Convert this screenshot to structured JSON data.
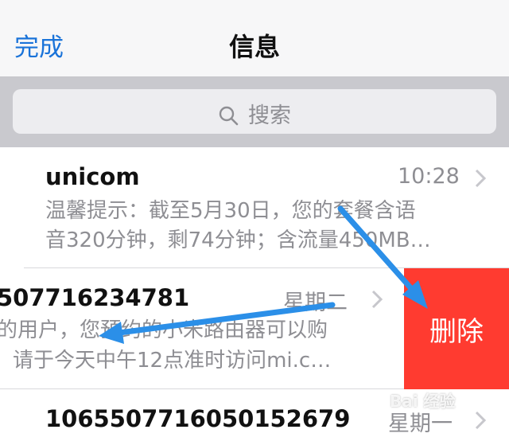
{
  "navbar": {
    "done_label": "完成",
    "title": "信息"
  },
  "search": {
    "placeholder": "搜索"
  },
  "messages": [
    {
      "sender": "unicom",
      "time": "10:28",
      "preview_line1": "温馨提示：截至5月30日，您的套餐含语",
      "preview_line2": "音320分钟，剩74分钟；含流量450MB…"
    },
    {
      "sender": "507716234781",
      "time": "星期二",
      "preview_line1": "的用户，您预约的小米路由器可以购",
      "preview_line2": "请于今天中午12点准时访问mi.c…"
    },
    {
      "sender": "1065507716050152679",
      "time": "星期一"
    }
  ],
  "swipe_action": {
    "delete_label": "删除",
    "color": "#ff3b30"
  },
  "annotation": {
    "arrow_color": "#2b8fe8"
  },
  "watermark": {
    "text": "Bai 经验"
  }
}
